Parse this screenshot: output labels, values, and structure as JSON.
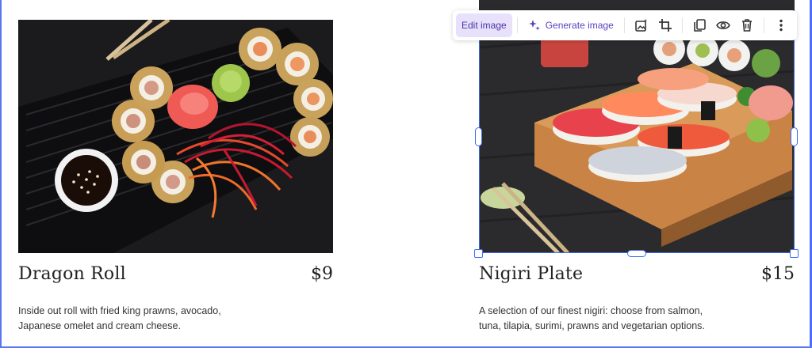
{
  "toolbar": {
    "edit_label": "Edit image",
    "generate_label": "Generate image",
    "icons": [
      "image-settings-icon",
      "crop-icon",
      "duplicate-icon",
      "preview-icon",
      "delete-icon",
      "more-icon"
    ]
  },
  "cards": [
    {
      "title": "Dragon Roll",
      "price": "$9",
      "description_line1": "Inside out roll with fried king prawns, avocado,",
      "description_line2": "Japanese omelet and cream cheese."
    },
    {
      "title": "Nigiri Plate",
      "price": "$15",
      "description_line1": "A selection of our finest nigiri: choose from salmon,",
      "description_line2": "tuna, tilapia, surimi, prawns and vegetarian options."
    }
  ],
  "colors": {
    "accent": "#3c6df0",
    "toolbar_text": "#5a3fbf",
    "toolbar_active_bg": "#e7e1fb"
  }
}
